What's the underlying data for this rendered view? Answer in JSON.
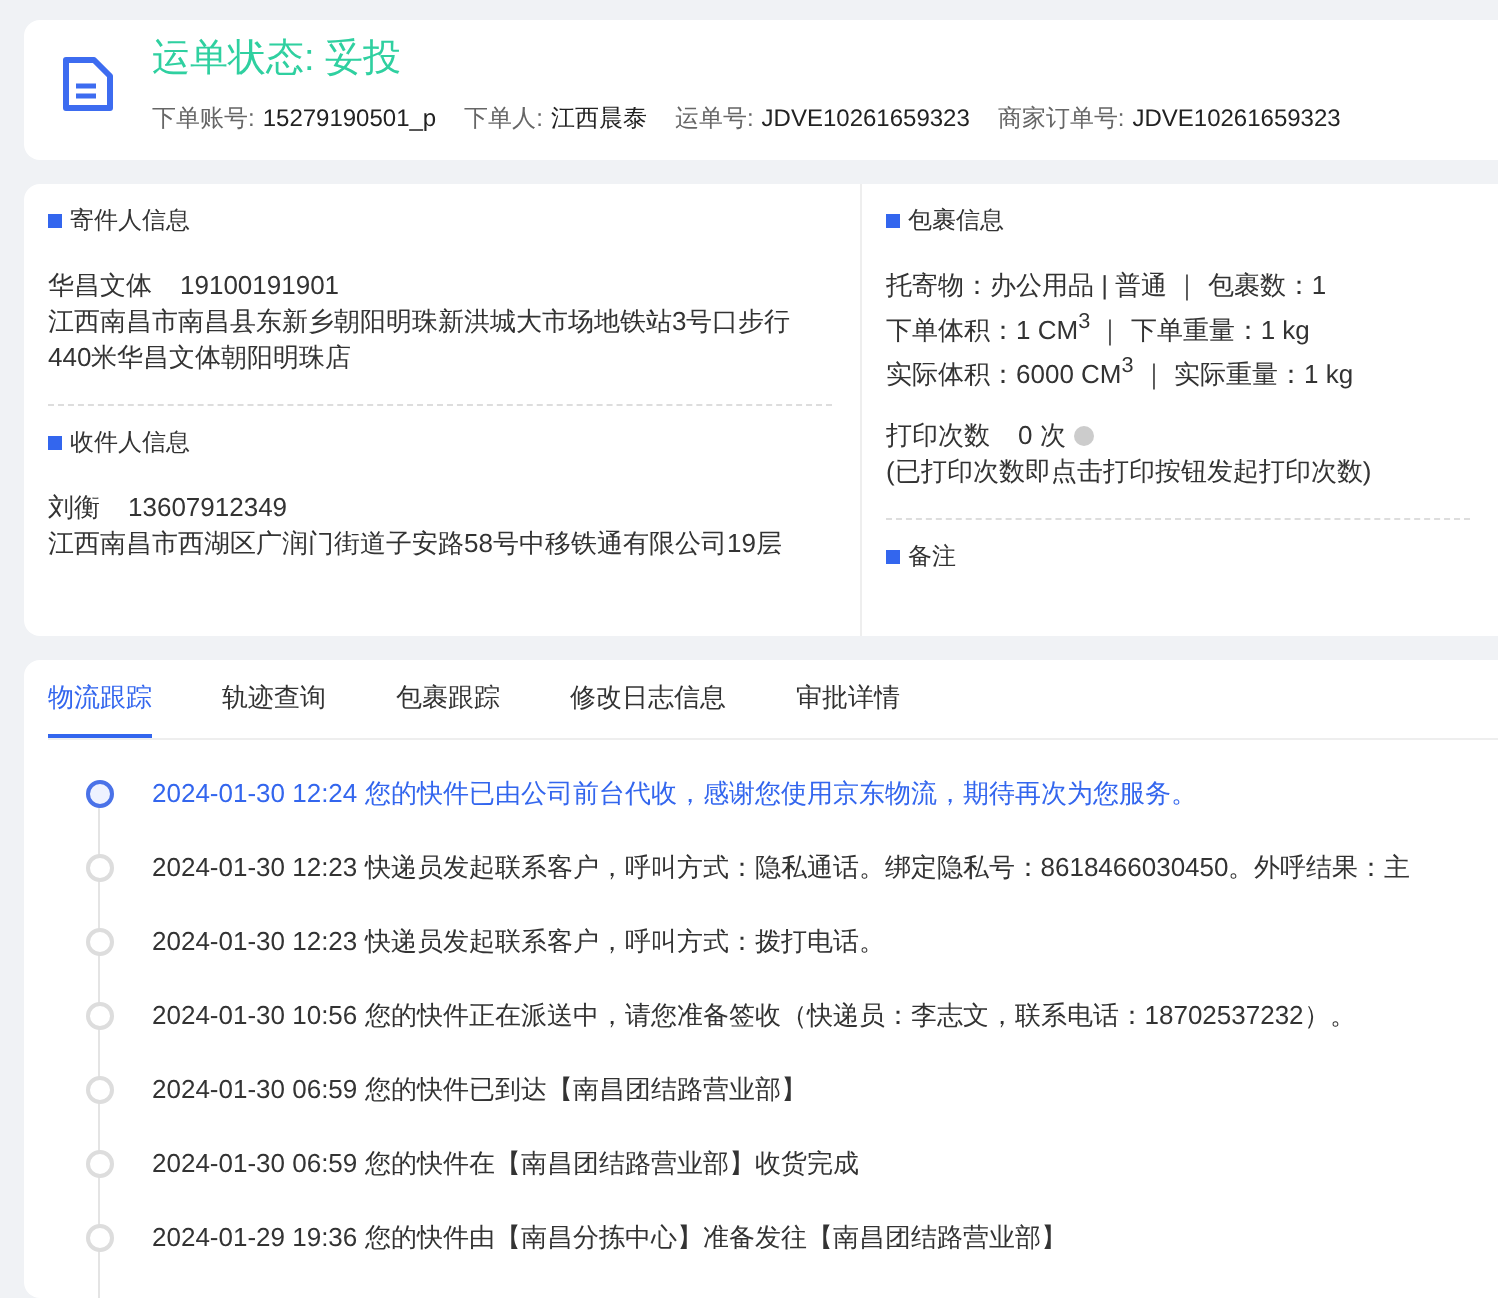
{
  "header": {
    "status": "运单状态: 妥投",
    "fields": [
      {
        "label": "下单账号:",
        "value": "15279190501_p"
      },
      {
        "label": "下单人:",
        "value": "江西晨泰"
      },
      {
        "label": "运单号:",
        "value": "JDVE10261659323"
      },
      {
        "label": "商家订单号:",
        "value": "JDVE10261659323"
      }
    ]
  },
  "sender": {
    "title": "寄件人信息",
    "name": "华昌文体",
    "phone": "19100191901",
    "address": "江西南昌市南昌县东新乡朝阳明珠新洪城大市场地铁站3号口步行440米华昌文体朝阳明珠店"
  },
  "receiver": {
    "title": "收件人信息",
    "name": "刘衡",
    "phone": "13607912349",
    "address": "江西南昌市西湖区广润门街道子安路58号中移铁通有限公司19层"
  },
  "package": {
    "title": "包裹信息",
    "lines": [
      "托寄物：办公用品 | 普通 ｜ 包裹数：1",
      "下单体积：1 CM$^{3}$ ｜ 下单重量：1 kg",
      "实际体积：6000 CM$^{3}$ ｜ 实际重量：1 kg"
    ],
    "print_label": "打印次数",
    "print_count": "0 次",
    "print_note": "(已打印次数即点击打印按钮发起打印次数)"
  },
  "remarks": {
    "title": "备注"
  },
  "tabs": [
    {
      "label": "物流跟踪",
      "selected": true
    },
    {
      "label": "轨迹查询",
      "selected": false
    },
    {
      "label": "包裹跟踪",
      "selected": false
    },
    {
      "label": "修改日志信息",
      "selected": false
    },
    {
      "label": "审批详情",
      "selected": false
    }
  ],
  "timeline": [
    {
      "text": "2024-01-30 12:24 您的快件已由公司前台代收，感谢您使用京东物流，期待再次为您服务。",
      "active": true
    },
    {
      "text": "2024-01-30 12:23 快递员发起联系客户，呼叫方式：隐私通话。绑定隐私号：8618466030450。外呼结果：主",
      "active": false
    },
    {
      "text": "2024-01-30 12:23 快递员发起联系客户，呼叫方式：拨打电话。",
      "active": false
    },
    {
      "text": "2024-01-30 10:56 您的快件正在派送中，请您准备签收（快递员：李志文，联系电话：18702537232）。",
      "active": false
    },
    {
      "text": "2024-01-30 06:59 您的快件已到达【南昌团结路营业部】",
      "active": false
    },
    {
      "text": "2024-01-30 06:59 您的快件在【南昌团结路营业部】收货完成",
      "active": false
    },
    {
      "text": "2024-01-29 19:36 您的快件由【南昌分拣中心】准备发往【南昌团结路营业部】",
      "active": false
    }
  ]
}
